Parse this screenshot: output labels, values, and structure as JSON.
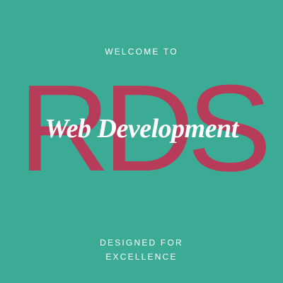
{
  "header": {
    "welcome_text": "WELCOME TO"
  },
  "logo": {
    "letters": "RDS",
    "title": "Web Development",
    "letters_color": "#b73c59"
  },
  "tagline": {
    "line1": "DESIGNED FOR",
    "line2": "EXCELLENCE"
  },
  "colors": {
    "background": "#3bab96",
    "text": "#ffffff"
  }
}
